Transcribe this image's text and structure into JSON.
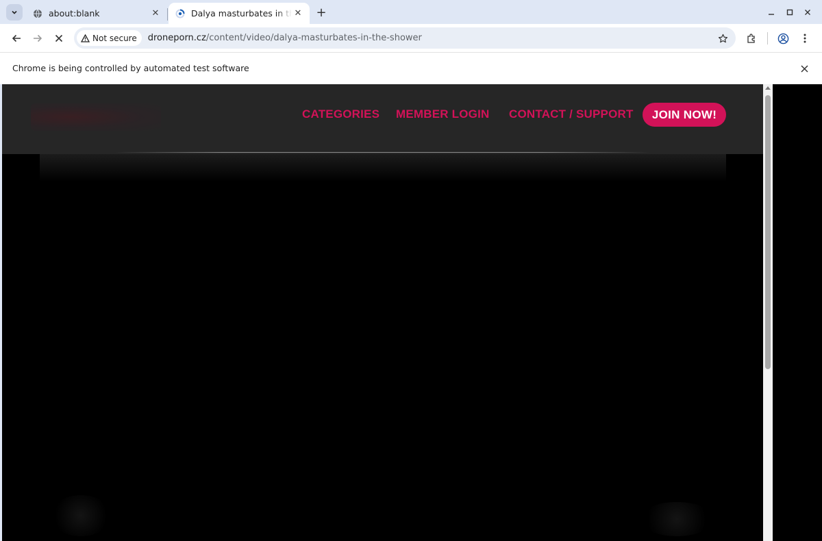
{
  "browser": {
    "tabs": [
      {
        "title": "about:blank",
        "active": false,
        "icon": "globe-icon"
      },
      {
        "title": "Dalya masturbates in the shower",
        "active": true,
        "icon": "loading-spinner-icon"
      }
    ],
    "security_label": "Not secure",
    "url_domain": "droneporn.cz",
    "url_path": "/content/video/dalya-masturbates-in-the-shower",
    "infobar_message": "Chrome is being controlled by automated test software"
  },
  "site": {
    "nav": {
      "categories": "CATEGORIES",
      "member_login": "MEMBER LOGIN",
      "contact_support": "CONTACT / SUPPORT",
      "join_now": "JOIN NOW!"
    },
    "colors": {
      "accent": "#d21258",
      "header_bg": "#262626",
      "page_bg": "#000000"
    }
  }
}
